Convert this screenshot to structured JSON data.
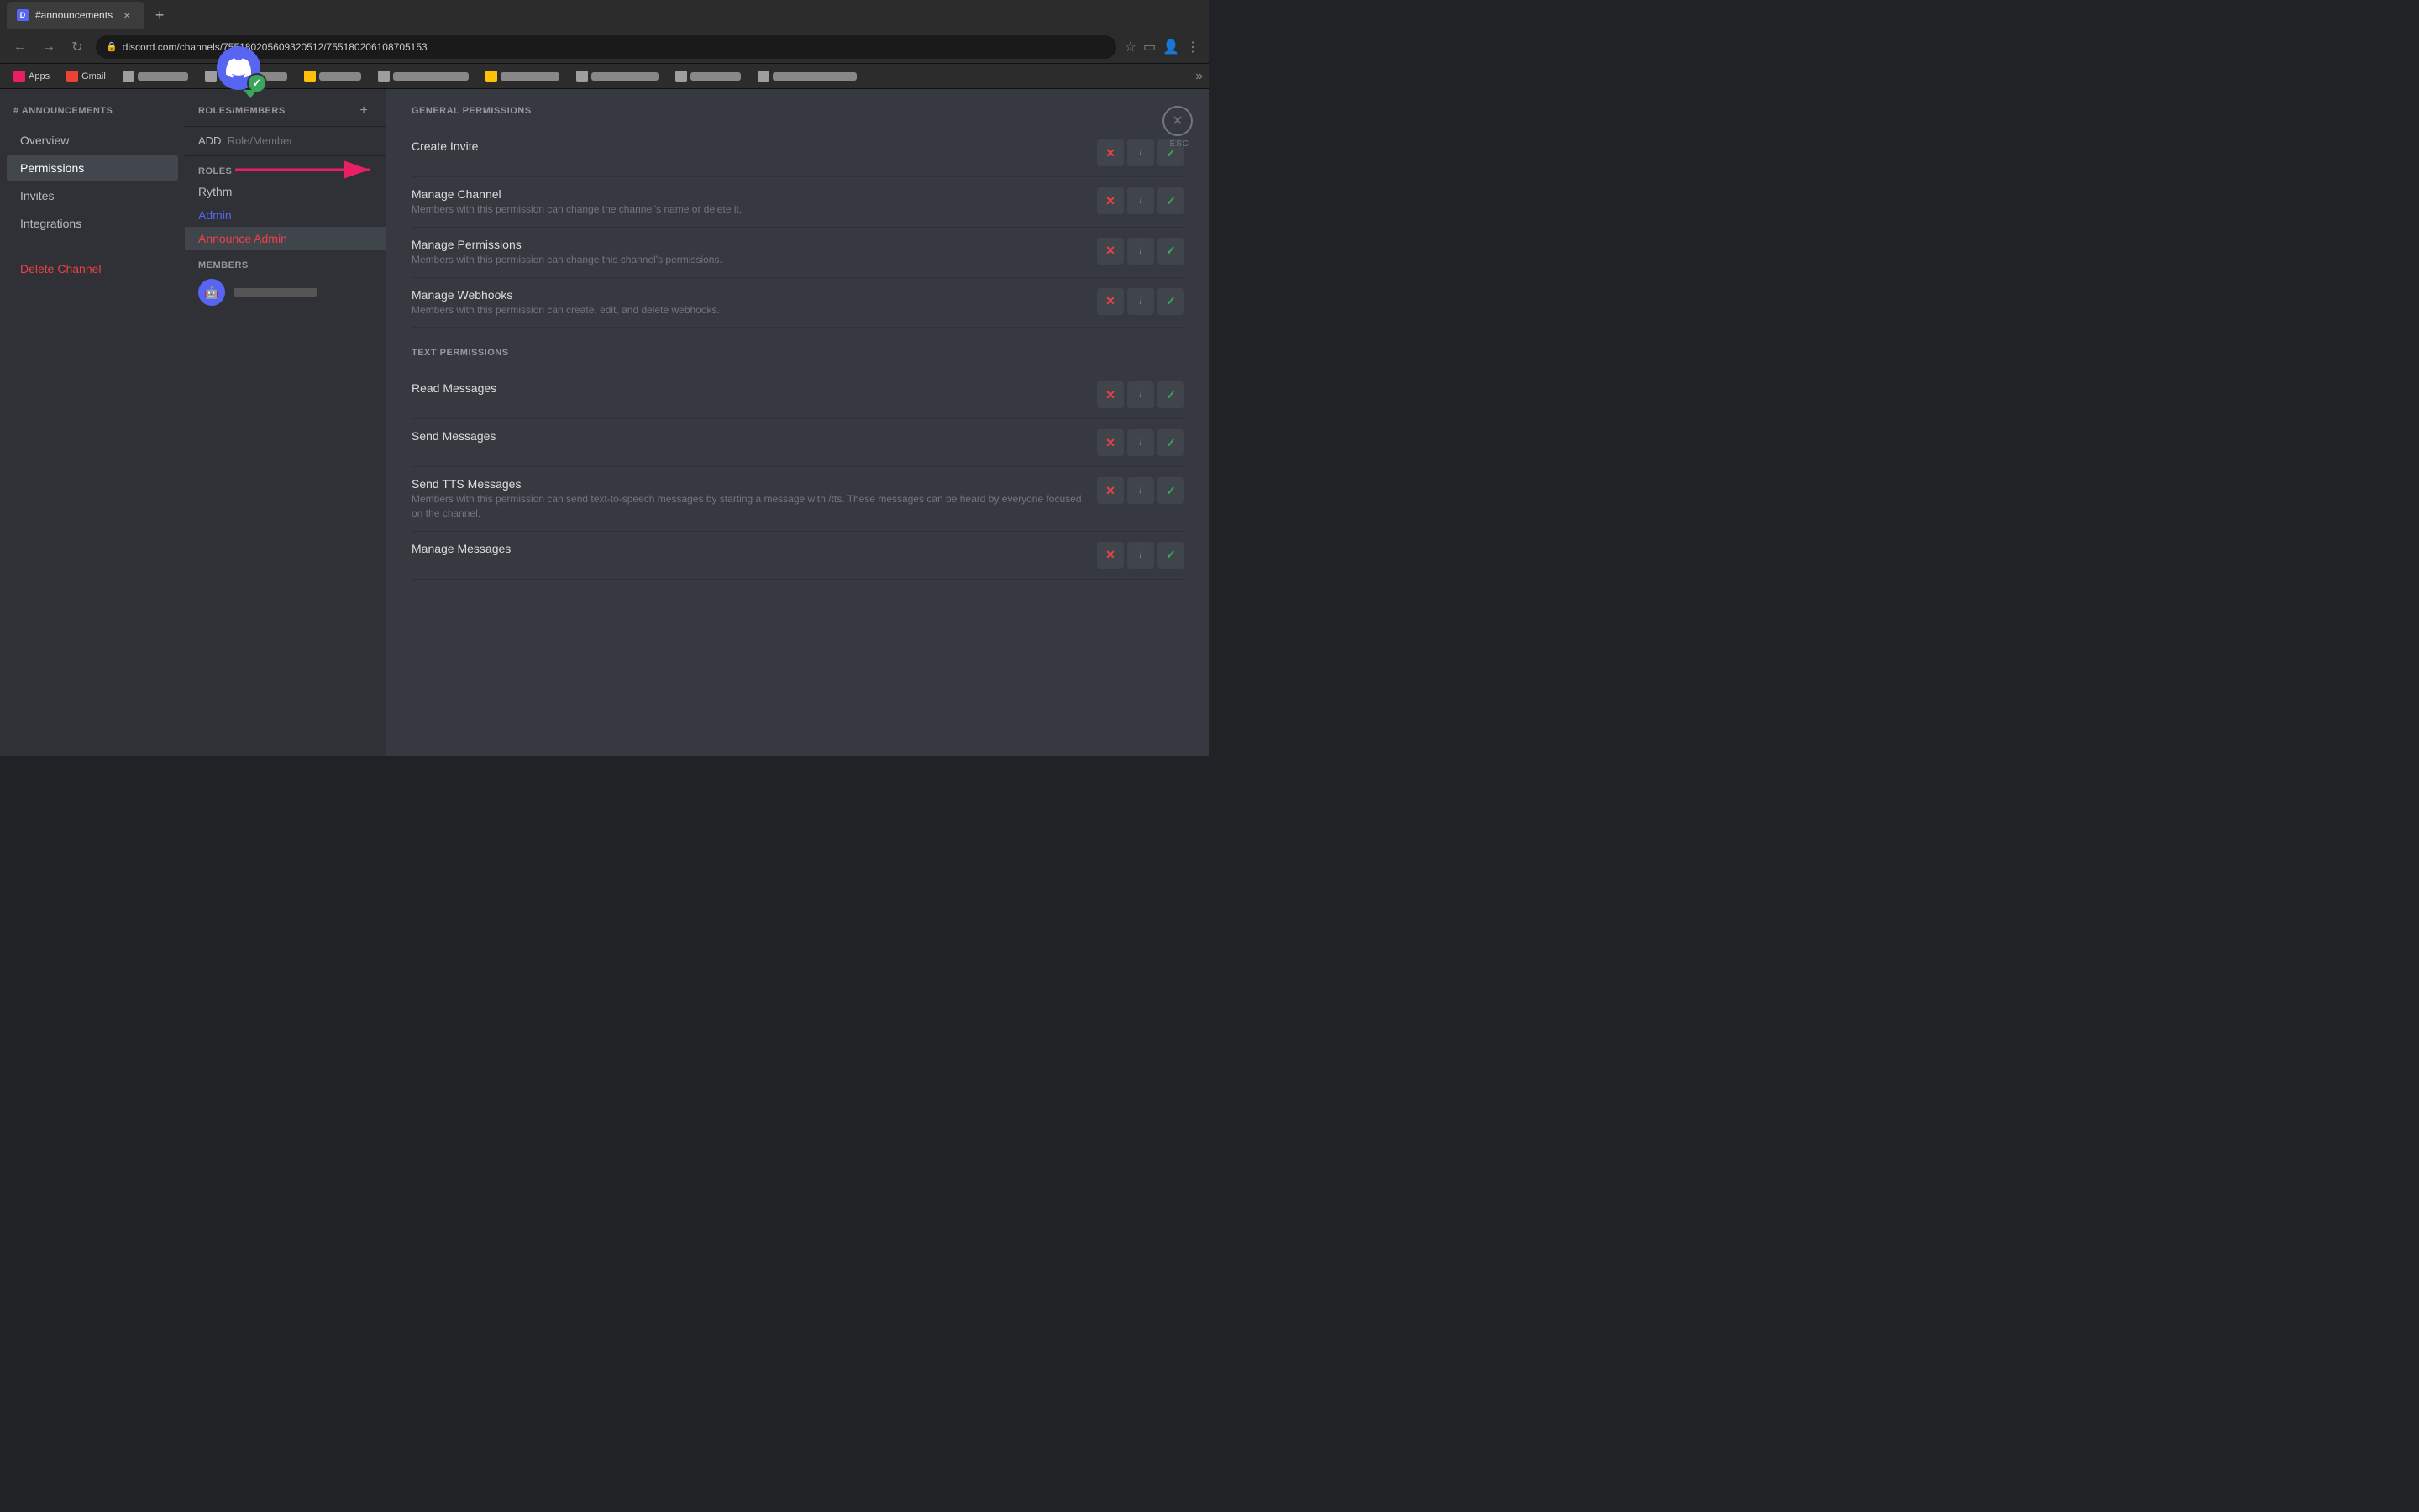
{
  "browser": {
    "tab": {
      "title": "#announcements",
      "favicon": "D"
    },
    "url": "discord.com/channels/755180205609320512/755180206108705153",
    "bookmarks": [
      {
        "label": "Apps",
        "color": "#e91e63"
      },
      {
        "label": "Gmail",
        "color": "#ea4335"
      },
      {
        "label": "",
        "color": "#9e9e9e"
      },
      {
        "label": "",
        "color": "#9e9e9e"
      },
      {
        "label": "",
        "color": "#ffc107"
      },
      {
        "label": "",
        "color": "#9e9e9e"
      },
      {
        "label": "",
        "color": "#9e9e9e"
      },
      {
        "label": "",
        "color": "#9e9e9e"
      },
      {
        "label": "",
        "color": "#9e9e9e"
      },
      {
        "label": "",
        "color": "#ffc107"
      },
      {
        "label": "",
        "color": "#9e9e9e"
      },
      {
        "label": "",
        "color": "#9e9e9e"
      },
      {
        "label": "",
        "color": "#9e9e9e"
      },
      {
        "label": "",
        "color": "#9e9e9e"
      },
      {
        "label": "",
        "color": "#9e9e9e"
      },
      {
        "label": "",
        "color": "#9e9e9e"
      },
      {
        "label": "",
        "color": "#9e9e9e"
      },
      {
        "label": "",
        "color": "#9e9e9e"
      }
    ]
  },
  "sidebar": {
    "channel_name": "# ANNOUNCEMENTS",
    "nav_items": [
      {
        "label": "Overview",
        "active": false
      },
      {
        "label": "Permissions",
        "active": true
      },
      {
        "label": "Invites",
        "active": false
      },
      {
        "label": "Integrations",
        "active": false
      },
      {
        "label": "Delete Channel",
        "danger": true
      }
    ]
  },
  "roles_panel": {
    "title": "ROLES/MEMBERS",
    "add_label": "ADD:",
    "add_placeholder": "Role/Member",
    "roles_section": "ROLES",
    "roles": [
      {
        "name": "Rythm",
        "color": "#b9bbbe",
        "selected": false
      },
      {
        "name": "Admin",
        "color": "#5865F2",
        "selected": false
      },
      {
        "name": "Announce Admin",
        "color": "#ed4245",
        "selected": true
      }
    ],
    "members_section": "MEMBERS",
    "members": [
      {
        "name": "blurred_user",
        "avatar_emoji": "🤖"
      }
    ]
  },
  "permissions_panel": {
    "general_section": "GENERAL PERMISSIONS",
    "text_section": "TEXT PERMISSIONS",
    "close_label": "ESC",
    "permissions": [
      {
        "name": "Create Invite",
        "desc": "",
        "deny": "×",
        "neutral": "/",
        "allow": "✓"
      },
      {
        "name": "Manage Channel",
        "desc": "Members with this permission can change the channel's name or delete it.",
        "deny": "×",
        "neutral": "/",
        "allow": "✓"
      },
      {
        "name": "Manage Permissions",
        "desc": "Members with this permission can change this channel's permissions.",
        "deny": "×",
        "neutral": "/",
        "allow": "✓"
      },
      {
        "name": "Manage Webhooks",
        "desc": "Members with this permission can create, edit, and delete webhooks.",
        "deny": "×",
        "neutral": "/",
        "allow": "✓"
      }
    ],
    "text_permissions": [
      {
        "name": "Read Messages",
        "desc": "",
        "deny": "×",
        "neutral": "/",
        "allow": "✓"
      },
      {
        "name": "Send Messages",
        "desc": "",
        "deny": "×",
        "neutral": "/",
        "allow": "✓"
      },
      {
        "name": "Send TTS Messages",
        "desc": "Members with this permission can send text-to-speech messages by starting a message with /tts. These messages can be heard by everyone focused on the channel.",
        "deny": "×",
        "neutral": "/",
        "allow": "✓"
      },
      {
        "name": "Manage Messages",
        "desc": "",
        "deny": "×",
        "neutral": "/",
        "allow": "✓"
      }
    ]
  }
}
